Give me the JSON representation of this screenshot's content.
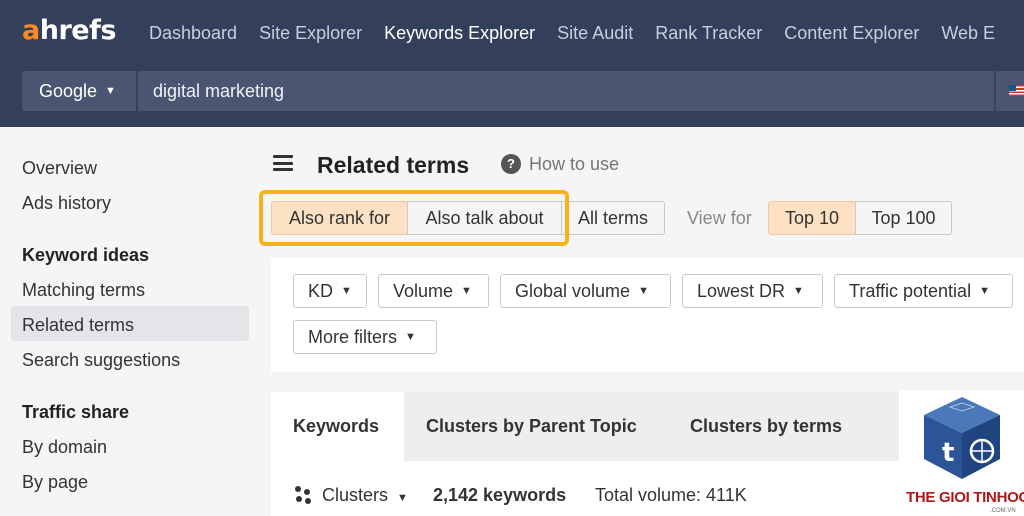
{
  "app": {
    "logo_a": "a",
    "logo_rest": "hrefs",
    "accent_color": "#ff8a1f",
    "nav_bg": "#34405b"
  },
  "nav": {
    "items": [
      {
        "label": "Dashboard",
        "active": false
      },
      {
        "label": "Site Explorer",
        "active": false
      },
      {
        "label": "Keywords Explorer",
        "active": true
      },
      {
        "label": "Site Audit",
        "active": false
      },
      {
        "label": "Rank Tracker",
        "active": false
      },
      {
        "label": "Content Explorer",
        "active": false
      },
      {
        "label": "Web E",
        "active": false
      }
    ]
  },
  "search": {
    "engine": "Google",
    "query": "digital marketing",
    "country_flag": "us-flag-icon"
  },
  "sidebar": {
    "items": [
      "Overview",
      "Ads history"
    ],
    "keyword_ideas_heading": "Keyword ideas",
    "keyword_ideas": [
      "Matching terms",
      "Related terms",
      "Search suggestions"
    ],
    "active_item": "Related terms",
    "traffic_share_heading": "Traffic share",
    "traffic_share": [
      "By domain",
      "By page"
    ]
  },
  "main": {
    "title": "Related terms",
    "help_label": "How to use",
    "modes": [
      {
        "label": "Also rank for",
        "active": true
      },
      {
        "label": "Also talk about",
        "active": false
      },
      {
        "label": "All terms",
        "active": false
      }
    ],
    "view_for_label": "View for",
    "view_for": [
      {
        "label": "Top 10",
        "active": true
      },
      {
        "label": "Top 100",
        "active": false
      }
    ],
    "filters": [
      "KD",
      "Volume",
      "Global volume",
      "Lowest DR",
      "Traffic potential",
      "More filters"
    ],
    "tabs": [
      {
        "label": "Keywords",
        "active": true
      },
      {
        "label": "Clusters by Parent Topic",
        "active": false
      },
      {
        "label": "Clusters by terms",
        "active": false
      }
    ],
    "clusters_label": "Clusters",
    "keyword_count": "2,142 keywords",
    "total_volume": "Total volume: 411K"
  },
  "watermark": {
    "text": "THE GIOI TINHOC",
    "subtext": ".COM.VN",
    "color": "#b01818"
  }
}
